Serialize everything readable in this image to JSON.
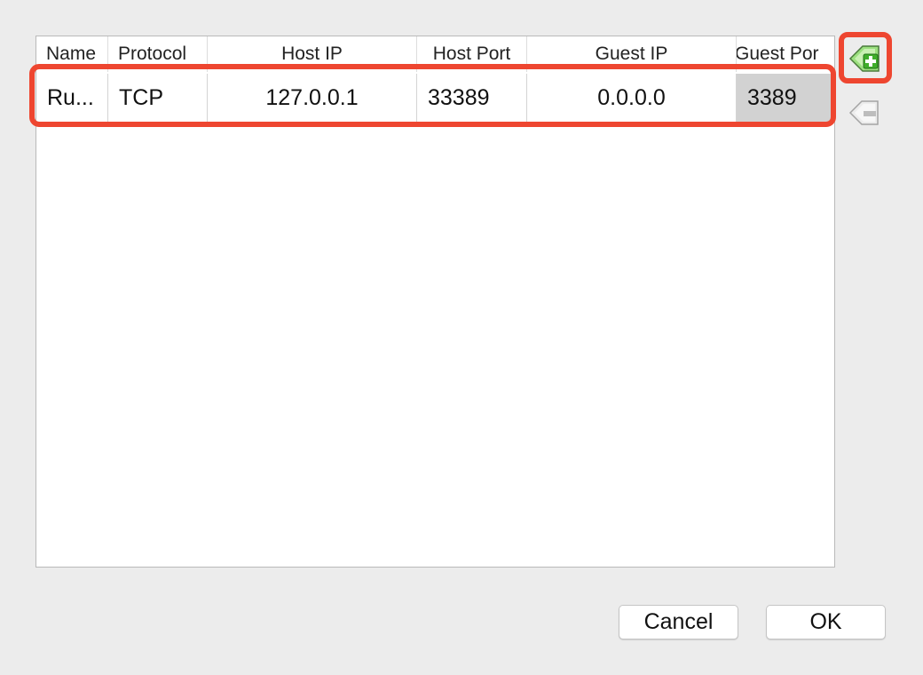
{
  "table": {
    "columns": [
      "Name",
      "Protocol",
      "Host IP",
      "Host Port",
      "Guest IP",
      "Guest Por"
    ],
    "rows": [
      {
        "name": "Ru...",
        "protocol": "TCP",
        "host_ip": "127.0.0.1",
        "host_port": "33389",
        "guest_ip": "0.0.0.0",
        "guest_port": "3389"
      }
    ]
  },
  "side_buttons": {
    "add_icon": "add-rule-icon",
    "remove_icon": "remove-rule-icon"
  },
  "buttons": {
    "cancel_label": "Cancel",
    "ok_label": "OK"
  },
  "colors": {
    "highlight": "#ee4630",
    "selected_cell": "#d2d2d2",
    "add_icon_green": "#3fae2a"
  }
}
